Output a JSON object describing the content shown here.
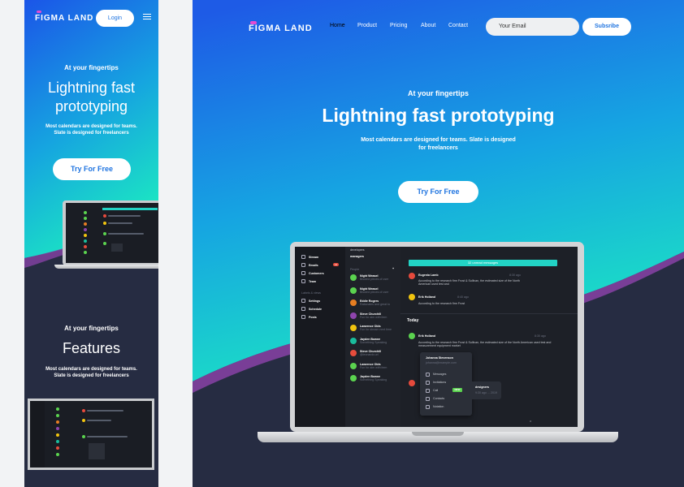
{
  "mobile": {
    "logo": "FIGMA LAND",
    "login_label": "Login",
    "hero_kicker": "At your fingertips",
    "hero_title_line1": "Lightning fast",
    "hero_title_line2": "prototyping",
    "hero_sub_line1": "Most calendars are designed for teams.",
    "hero_sub_line2": "Slate is designed for freelancers",
    "cta_label": "Try For Free",
    "features_kicker": "At your fingertips",
    "features_title": "Features",
    "features_sub_line1": "Most calendars are designed for teams.",
    "features_sub_line2": "Slate is designed for freelancers"
  },
  "desktop": {
    "logo": "FIGMA LAND",
    "nav": [
      "Home",
      "Product",
      "Pricing",
      "About",
      "Contact"
    ],
    "email_placeholder": "Your Email",
    "subscribe_label": "Subsribe",
    "hero_kicker": "At your fingertips",
    "hero_title": "Lightning fast prototyping",
    "hero_sub_line1": "Most calendars are designed for teams. Slate is designed",
    "hero_sub_line2": "for freelancers",
    "cta_label": "Try For Free"
  },
  "app": {
    "sidebar": [
      "Stream",
      "Emails",
      "Customers",
      "Team",
      "Settings",
      "Schedule",
      "Posts"
    ],
    "sidebar_section": "Labels & views",
    "emails_badge": "12",
    "channel_top": "developers",
    "channel_title": "managers",
    "people_header": "People",
    "contacts": [
      {
        "name": "Night Weasel",
        "sub": "Bisuted pieces of user"
      },
      {
        "name": "Night Weasel",
        "sub": "Bisuted pieces of user"
      },
      {
        "name": "Eddie Rogers",
        "sub": "Rationales and great to"
      },
      {
        "name": "Steve Churchill",
        "sub": "Fun for aim with item"
      },
      {
        "name": "Lawrence Olds",
        "sub": "Fun for stream next time"
      },
      {
        "name": "Jayden Bowne",
        "sub": "Something Speaking"
      },
      {
        "name": "Steve Churchill",
        "sub": "@leonardo.url"
      },
      {
        "name": "Lawrence Olds",
        "sub": "Fun for aim with item"
      },
      {
        "name": "Jayden Bowne",
        "sub": "Something Speaking"
      }
    ],
    "banner": "32 unread messages",
    "messages": [
      {
        "name": "Eugenia Lamb",
        "time": "8:30 ago",
        "text1": "According to the research firm Frost & Sullivan, the estimated size of the North",
        "text2": "American used test and"
      },
      {
        "name": "Erik Holland",
        "time": "8:40 ago",
        "text1": "According to the research firm Frost"
      },
      {
        "name": "Erik Holland",
        "time": "8:30 ago",
        "text1": "According to the research firm Frost & Sullivan, the estimated size of the North American used test and",
        "text2": "measurement equipment market"
      }
    ],
    "day_label": "Today",
    "popup": {
      "name": "Johanna Stevenson",
      "sub": "johanna@example.com",
      "items": [
        "Messages",
        "Invitations",
        "Call",
        "Contacts",
        "Notation"
      ],
      "badge": "NEW"
    },
    "peek": {
      "title": "designers",
      "sub": "9:30 ago ... 2019"
    }
  },
  "colors": {
    "grad_top": "#1c5ee6",
    "grad_bottom": "#18e5c5",
    "dark": "#262c42",
    "accent": "#e44bd2",
    "teal": "#22d3c5"
  }
}
